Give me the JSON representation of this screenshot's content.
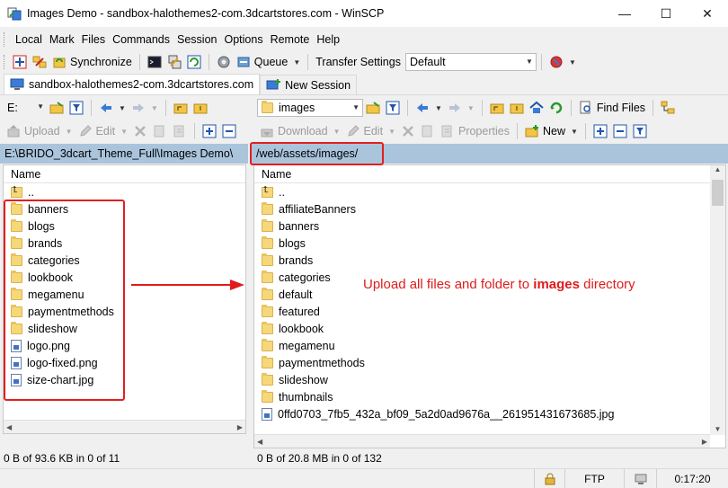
{
  "window": {
    "title": "Images Demo - sandbox-halothemes2-com.3dcartstores.com - WinSCP"
  },
  "menu": [
    "Local",
    "Mark",
    "Files",
    "Commands",
    "Session",
    "Options",
    "Remote",
    "Help"
  ],
  "toolbar": {
    "synchronize": "Synchronize",
    "queue": "Queue",
    "transfer_settings_label": "Transfer Settings",
    "transfer_settings_value": "Default"
  },
  "tabs": [
    {
      "label": "sandbox-halothemes2-com.3dcartstores.com"
    },
    {
      "label": "New Session"
    }
  ],
  "local": {
    "drive": "E:",
    "path": "E:\\BRIDO_3dcart_Theme_Full\\Images Demo\\",
    "upload": "Upload",
    "edit": "Edit",
    "column_name": "Name",
    "parent": "..",
    "items": [
      {
        "name": "banners",
        "type": "folder"
      },
      {
        "name": "blogs",
        "type": "folder"
      },
      {
        "name": "brands",
        "type": "folder"
      },
      {
        "name": "categories",
        "type": "folder"
      },
      {
        "name": "lookbook",
        "type": "folder"
      },
      {
        "name": "megamenu",
        "type": "folder"
      },
      {
        "name": "paymentmethods",
        "type": "folder"
      },
      {
        "name": "slideshow",
        "type": "folder"
      },
      {
        "name": "logo.png",
        "type": "file"
      },
      {
        "name": "logo-fixed.png",
        "type": "file"
      },
      {
        "name": "size-chart.jpg",
        "type": "file"
      }
    ],
    "status": "0 B of 93.6 KB in 0 of 11"
  },
  "remote": {
    "folder": "images",
    "find_files": "Find Files",
    "download": "Download",
    "edit": "Edit",
    "properties": "Properties",
    "new": "New",
    "path": "/web/assets/images/",
    "column_name": "Name",
    "parent": "..",
    "items": [
      {
        "name": "affiliateBanners",
        "type": "folder"
      },
      {
        "name": "banners",
        "type": "folder"
      },
      {
        "name": "blogs",
        "type": "folder"
      },
      {
        "name": "brands",
        "type": "folder"
      },
      {
        "name": "categories",
        "type": "folder"
      },
      {
        "name": "default",
        "type": "folder"
      },
      {
        "name": "featured",
        "type": "folder"
      },
      {
        "name": "lookbook",
        "type": "folder"
      },
      {
        "name": "megamenu",
        "type": "folder"
      },
      {
        "name": "paymentmethods",
        "type": "folder"
      },
      {
        "name": "slideshow",
        "type": "folder"
      },
      {
        "name": "thumbnails",
        "type": "folder"
      },
      {
        "name": "0ffd0703_7fb5_432a_bf09_5a2d0ad9676a__261951431673685.jpg",
        "type": "file"
      }
    ],
    "status": "0 B of 20.8 MB in 0 of 132"
  },
  "statusbar": {
    "protocol": "FTP",
    "time": "0:17:20"
  },
  "annotation": {
    "prefix": "Upload all files and folder to ",
    "bold": "images",
    "suffix": " directory"
  },
  "colors": {
    "annotation": "#e01b1b",
    "path_bar": "#aac4dc"
  }
}
